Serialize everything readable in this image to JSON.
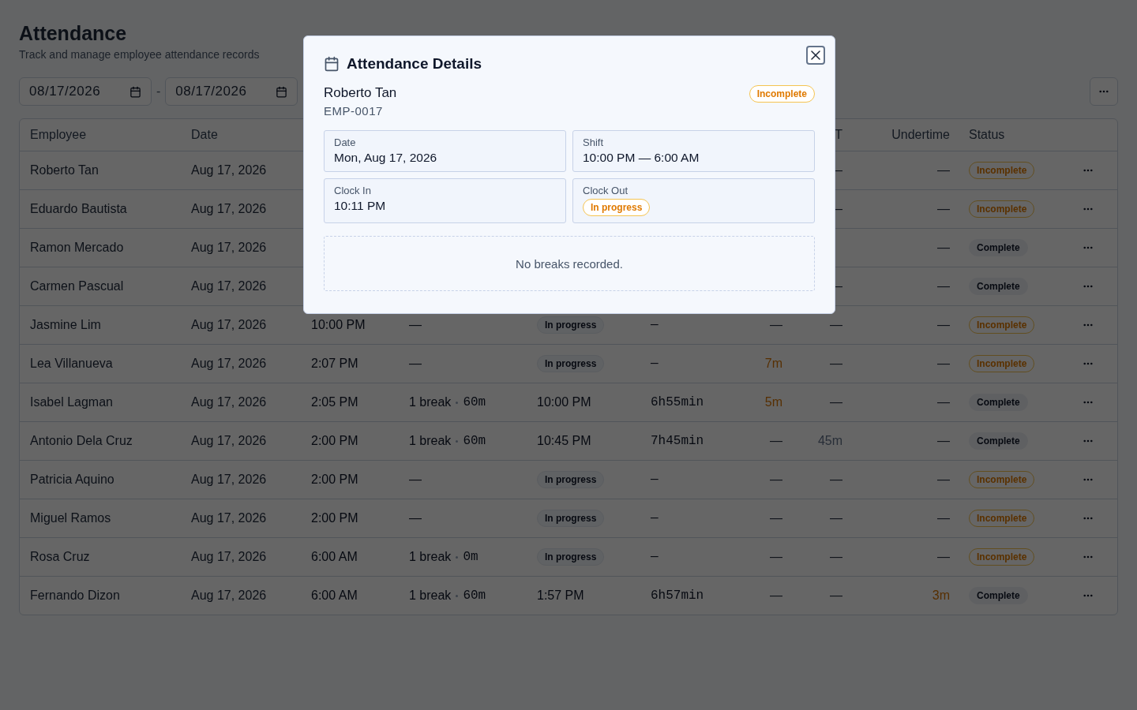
{
  "page": {
    "title": "Attendance",
    "subtitle": "Track and manage employee attendance records"
  },
  "filters": {
    "start_date": "08/17/2026",
    "separator": "-",
    "end_date": "08/17/2026"
  },
  "table": {
    "header": {
      "employee": "Employee",
      "date": "Date",
      "ot": "T",
      "undertime": "Undertime",
      "status": "Status"
    },
    "rows": [
      {
        "employee": "Roberto Tan",
        "date": "Aug 17, 2026",
        "ot": {
          "text": "—",
          "flagged": false
        },
        "undertime": {
          "text": "—",
          "flagged": false
        },
        "status": {
          "text": "Incomplete",
          "kind": "incomplete"
        }
      },
      {
        "employee": "Eduardo Bautista",
        "date": "Aug 17, 2026",
        "ot": {
          "text": "—",
          "flagged": false
        },
        "undertime": {
          "text": "—",
          "flagged": false
        },
        "status": {
          "text": "Incomplete",
          "kind": "incomplete"
        }
      },
      {
        "employee": "Ramon Mercado",
        "date": "Aug 17, 2026",
        "undertime": {
          "text": "—",
          "flagged": false
        },
        "status": {
          "text": "Complete",
          "kind": "complete"
        }
      },
      {
        "employee": "Carmen Pascual",
        "date": "Aug 17, 2026",
        "ot": {
          "text": "—",
          "flagged": false
        },
        "undertime": {
          "text": "—",
          "flagged": false
        },
        "status": {
          "text": "Complete",
          "kind": "complete"
        }
      },
      {
        "employee": "Jasmine Lim",
        "date": "Aug 17, 2026",
        "clock_in": "10:00 PM",
        "breaks": {
          "kind": "none",
          "text": "—"
        },
        "clock_out": {
          "kind": "pending",
          "text": "In progress"
        },
        "hours": "—",
        "late": {
          "text": "—",
          "flagged": false
        },
        "ot": {
          "text": "—",
          "flagged": false
        },
        "undertime": {
          "text": "—",
          "flagged": false
        },
        "status": {
          "text": "Incomplete",
          "kind": "incomplete"
        }
      },
      {
        "employee": "Lea Villanueva",
        "date": "Aug 17, 2026",
        "clock_in": "2:07 PM",
        "breaks": {
          "kind": "none",
          "text": "—"
        },
        "clock_out": {
          "kind": "pending",
          "text": "In progress"
        },
        "hours": "—",
        "late": {
          "text": "7m",
          "flagged": true
        },
        "ot": {
          "text": "—",
          "flagged": false
        },
        "undertime": {
          "text": "—",
          "flagged": false
        },
        "status": {
          "text": "Incomplete",
          "kind": "incomplete"
        }
      },
      {
        "employee": "Isabel Lagman",
        "date": "Aug 17, 2026",
        "clock_in": "2:05 PM",
        "breaks": {
          "kind": "count",
          "text": "1 break",
          "minutes": "60m"
        },
        "clock_out": {
          "kind": "time",
          "text": "10:00 PM"
        },
        "hours": "6h55min",
        "late": {
          "text": "5m",
          "flagged": true
        },
        "ot": {
          "text": "—",
          "flagged": false
        },
        "undertime": {
          "text": "—",
          "flagged": false
        },
        "status": {
          "text": "Complete",
          "kind": "complete"
        }
      },
      {
        "employee": "Antonio Dela Cruz",
        "date": "Aug 17, 2026",
        "clock_in": "2:00 PM",
        "breaks": {
          "kind": "count",
          "text": "1 break",
          "minutes": "60m"
        },
        "clock_out": {
          "kind": "time",
          "text": "10:45 PM"
        },
        "hours": "7h45min",
        "late": {
          "text": "—",
          "flagged": false
        },
        "ot": {
          "text": "45m",
          "flagged": true
        },
        "undertime": {
          "text": "—",
          "flagged": false
        },
        "status": {
          "text": "Complete",
          "kind": "complete"
        }
      },
      {
        "employee": "Patricia Aquino",
        "date": "Aug 17, 2026",
        "clock_in": "2:00 PM",
        "breaks": {
          "kind": "none",
          "text": "—"
        },
        "clock_out": {
          "kind": "pending",
          "text": "In progress"
        },
        "hours": "—",
        "late": {
          "text": "—",
          "flagged": false
        },
        "ot": {
          "text": "—",
          "flagged": false
        },
        "undertime": {
          "text": "—",
          "flagged": false
        },
        "status": {
          "text": "Incomplete",
          "kind": "incomplete"
        }
      },
      {
        "employee": "Miguel Ramos",
        "date": "Aug 17, 2026",
        "clock_in": "2:00 PM",
        "breaks": {
          "kind": "none",
          "text": "—"
        },
        "clock_out": {
          "kind": "pending",
          "text": "In progress"
        },
        "hours": "—",
        "late": {
          "text": "—",
          "flagged": false
        },
        "ot": {
          "text": "—",
          "flagged": false
        },
        "undertime": {
          "text": "—",
          "flagged": false
        },
        "status": {
          "text": "Incomplete",
          "kind": "incomplete"
        }
      },
      {
        "employee": "Rosa Cruz",
        "date": "Aug 17, 2026",
        "clock_in": "6:00 AM",
        "breaks": {
          "kind": "count",
          "text": "1 break",
          "minutes": "0m"
        },
        "clock_out": {
          "kind": "pending",
          "text": "In progress"
        },
        "hours": "—",
        "late": {
          "text": "—",
          "flagged": false
        },
        "ot": {
          "text": "—",
          "flagged": false
        },
        "undertime": {
          "text": "—",
          "flagged": false
        },
        "status": {
          "text": "Incomplete",
          "kind": "incomplete"
        }
      },
      {
        "employee": "Fernando Dizon",
        "date": "Aug 17, 2026",
        "clock_in": "6:00 AM",
        "breaks": {
          "kind": "count",
          "text": "1 break",
          "minutes": "60m"
        },
        "clock_out": {
          "kind": "time",
          "text": "1:57 PM"
        },
        "hours": "6h57min",
        "late": {
          "text": "—",
          "flagged": false
        },
        "ot": {
          "text": "—",
          "flagged": false
        },
        "undertime": {
          "text": "3m",
          "flagged": true
        },
        "status": {
          "text": "Complete",
          "kind": "complete"
        }
      }
    ]
  },
  "modal": {
    "title": "Attendance Details",
    "employee_name": "Roberto Tan",
    "employee_id": "EMP-0017",
    "status": {
      "text": "Incomplete",
      "kind": "incomplete"
    },
    "fields": [
      {
        "label": "Date",
        "value": {
          "kind": "text",
          "text": "Mon, Aug 17, 2026"
        }
      },
      {
        "label": "Shift",
        "value": {
          "kind": "text",
          "text": "10:00 PM — 6:00 AM"
        }
      },
      {
        "label": "Clock In",
        "value": {
          "kind": "text",
          "text": "10:11 PM"
        }
      },
      {
        "label": "Clock Out",
        "value": {
          "kind": "pending",
          "text": "In progress"
        }
      }
    ],
    "breaks_message": "No breaks recorded."
  }
}
